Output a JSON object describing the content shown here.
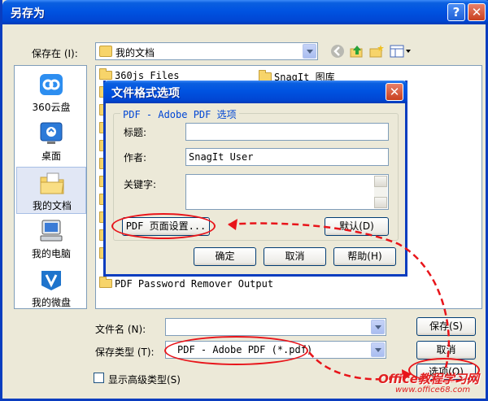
{
  "window": {
    "title": "另存为"
  },
  "toolbar": {
    "save_in_label": "保存在 (I):",
    "save_in_value": "我的文档"
  },
  "places": [
    {
      "label": "360云盘",
      "icon": "cloud-drive-icon"
    },
    {
      "label": "桌面",
      "icon": "desktop-icon"
    },
    {
      "label": "我的文档",
      "icon": "my-documents-icon"
    },
    {
      "label": "我的电脑",
      "icon": "my-computer-icon"
    },
    {
      "label": "我的微盘",
      "icon": "weipan-icon"
    }
  ],
  "files": {
    "col1": [
      "360js Files"
    ],
    "col2": [
      "SnagIt 图库"
    ],
    "bottom": "PDF Password Remover Output"
  },
  "bottom": {
    "filename_label": "文件名 (N):",
    "filename_value": "",
    "filetype_label": "保存类型 (T):",
    "filetype_value": "PDF - Adobe PDF (*.pdf)",
    "save_button": "保存(S)",
    "cancel_button": "取消",
    "options_button": "选项(O)",
    "advanced_label": "显示高级类型(S)"
  },
  "dialog": {
    "title": "文件格式选项",
    "group_label": "PDF - Adobe PDF 选项",
    "fields": {
      "title_label": "标题:",
      "title_value": "",
      "author_label": "作者:",
      "author_value": "SnagIt User",
      "keywords_label": "关键字:",
      "keywords_value": ""
    },
    "page_setup_button": "PDF 页面设置...",
    "default_button": "默认(D)",
    "ok_button": "确定",
    "cancel_button": "取消",
    "help_button": "帮助(H)"
  },
  "watermark": {
    "brand": "Office教程学习网",
    "url": "www.office68.com"
  },
  "colors": {
    "titlebar": "#0053e1",
    "annotation": "#e8141a",
    "window_bg": "#ece9d8"
  }
}
